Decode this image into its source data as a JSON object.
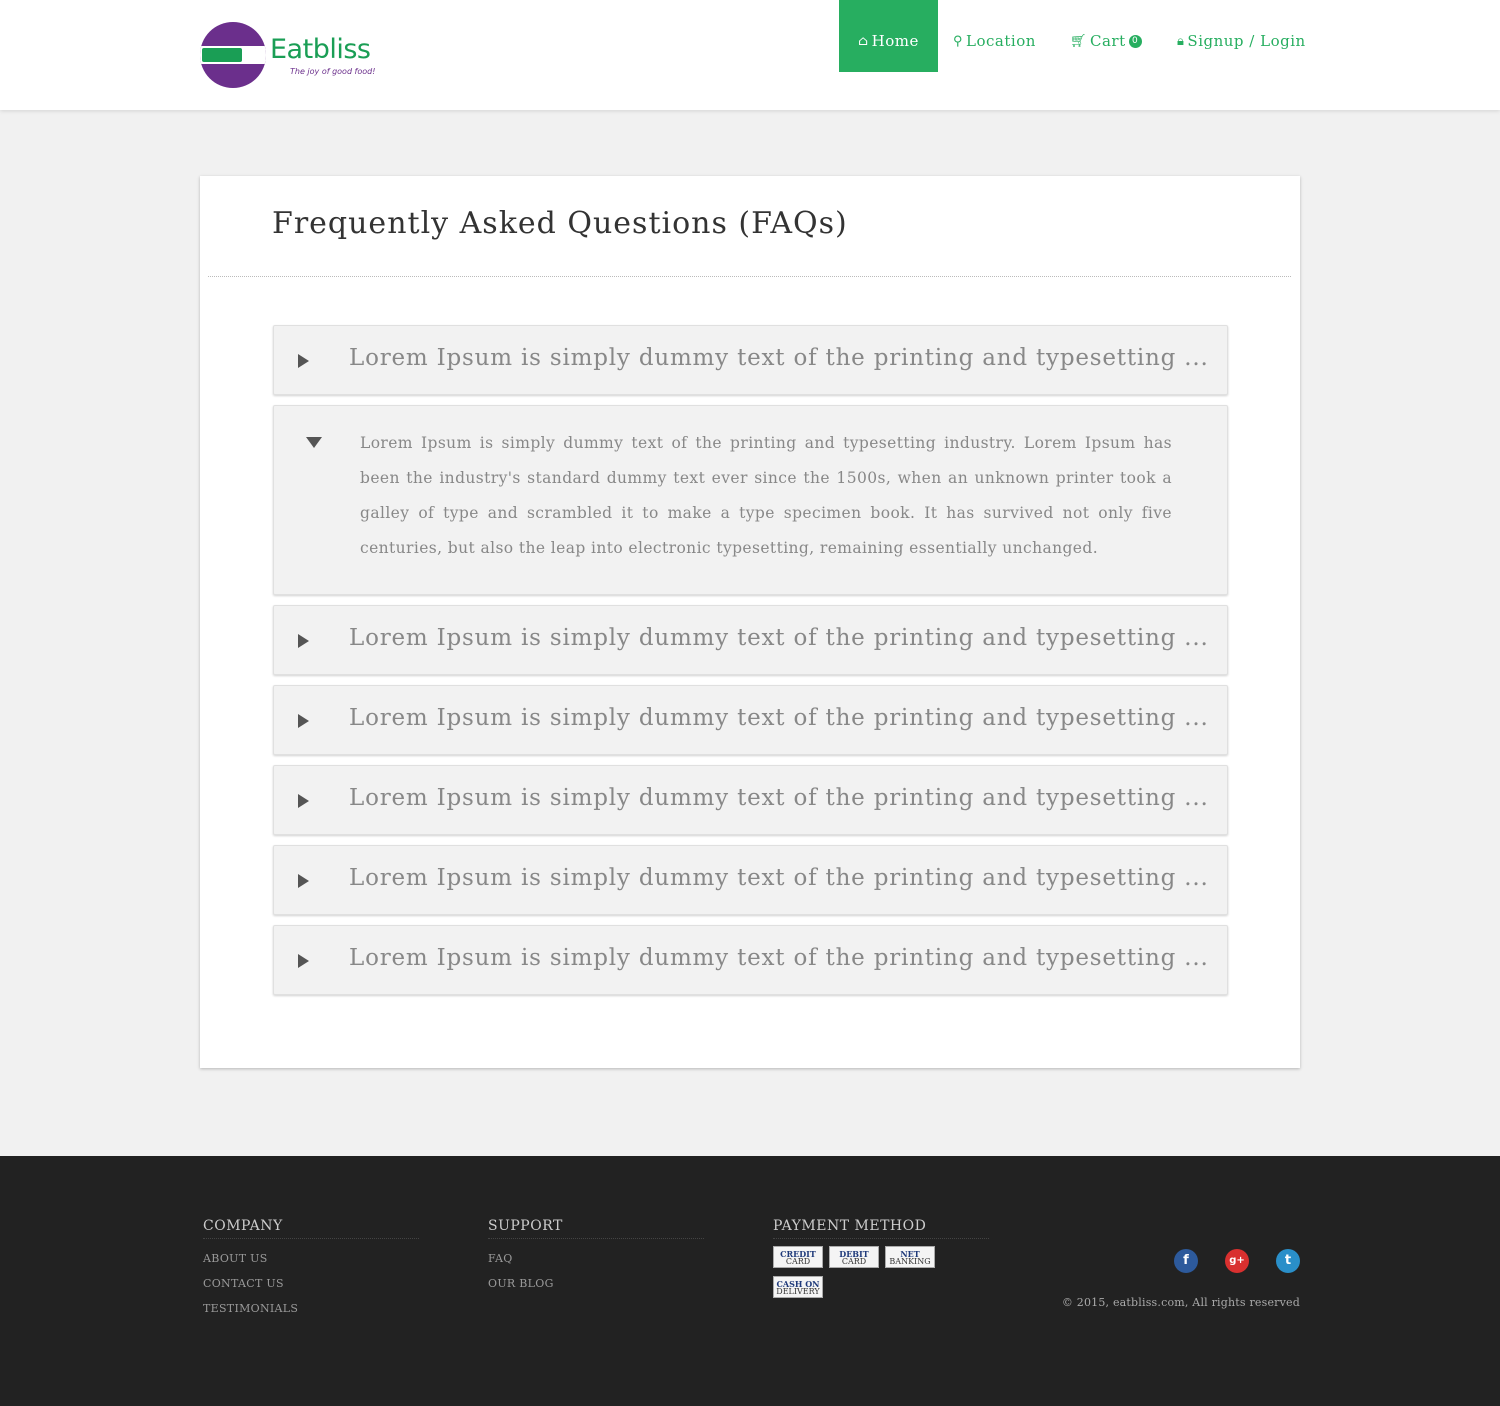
{
  "header": {
    "logo_name": "Eatbliss",
    "logo_tagline": "The joy of good food!",
    "nav": {
      "home": "Home",
      "location": "Location",
      "cart": "Cart",
      "cart_count": "0",
      "login": "Signup / Login"
    },
    "icons": {
      "home": "home-icon",
      "location": "map-marker-icon",
      "cart": "shopping-cart-icon",
      "login": "lock-icon"
    },
    "accent_color": "#27ae60",
    "brand_purple": "#6b2f8c"
  },
  "faq": {
    "title": "Frequently Asked Questions (FAQs)",
    "items": [
      {
        "question": "Lorem Ipsum is simply dummy text of the printing and typesetting ...",
        "expanded": false
      },
      {
        "answer": "Lorem Ipsum is simply dummy text of the printing and typesetting industry. Lorem Ipsum has been the industry's standard dummy text ever since the 1500s, when an unknown printer took a galley of type and scrambled it to make a type specimen book. It has survived not only five centuries, but also the leap into electronic typesetting, remaining essentially unchanged.",
        "expanded": true
      },
      {
        "question": "Lorem Ipsum is simply dummy text of the printing and typesetting ...",
        "expanded": false
      },
      {
        "question": "Lorem Ipsum is simply dummy text of the printing and typesetting ...",
        "expanded": false
      },
      {
        "question": "Lorem Ipsum is simply dummy text of the printing and typesetting ...",
        "expanded": false
      },
      {
        "question": "Lorem Ipsum is simply dummy text of the printing and typesetting ...",
        "expanded": false
      },
      {
        "question": "Lorem Ipsum is simply dummy text of the printing and typesetting ...",
        "expanded": false
      }
    ]
  },
  "footer": {
    "company": {
      "heading": "COMPANY",
      "links": [
        "ABOUT US",
        "CONTACT US",
        "TESTIMONIALS"
      ]
    },
    "support": {
      "heading": "SUPPORT",
      "links": [
        "FAQ",
        "OUR BLOG"
      ]
    },
    "payment": {
      "heading": "PAYMENT METHOD",
      "methods": [
        {
          "line1": "CREDIT",
          "line2": "CARD"
        },
        {
          "line1": "DEBIT",
          "line2": "CARD"
        },
        {
          "line1": "NET",
          "line2": "BANKING"
        },
        {
          "line1": "CASH ON",
          "line2": "DELIVERY"
        }
      ]
    },
    "social": {
      "facebook": "f",
      "google_plus": "g+",
      "twitter": "t"
    },
    "copyright": "© 2015, eatbliss.com, All rights reserved"
  }
}
